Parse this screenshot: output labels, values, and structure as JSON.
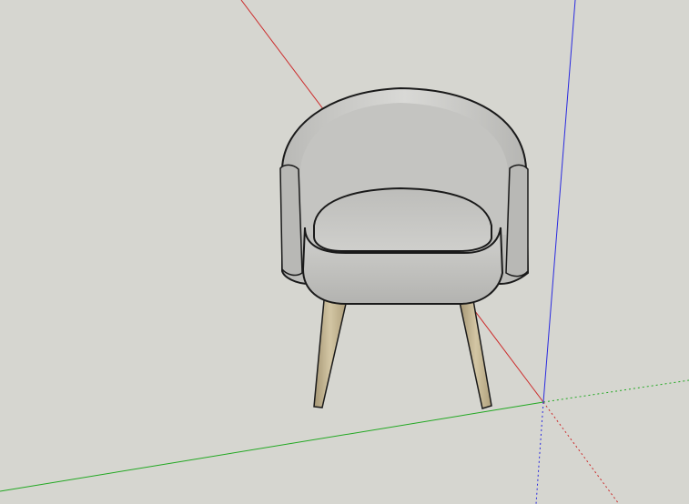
{
  "viewport": {
    "background_color": "#d6d6d0"
  },
  "axes": {
    "red_axis_color": "#cc2a2a",
    "green_axis_color": "#22a822",
    "blue_axis_color": "#2a2ae0"
  },
  "model": {
    "name": "armchair",
    "upholstery_color": "#c9c9c6",
    "upholstery_shadow": "#a9a9a6",
    "leg_color": "#c8b996",
    "leg_shadow": "#a59674",
    "outline_color": "#1a1a1a"
  }
}
